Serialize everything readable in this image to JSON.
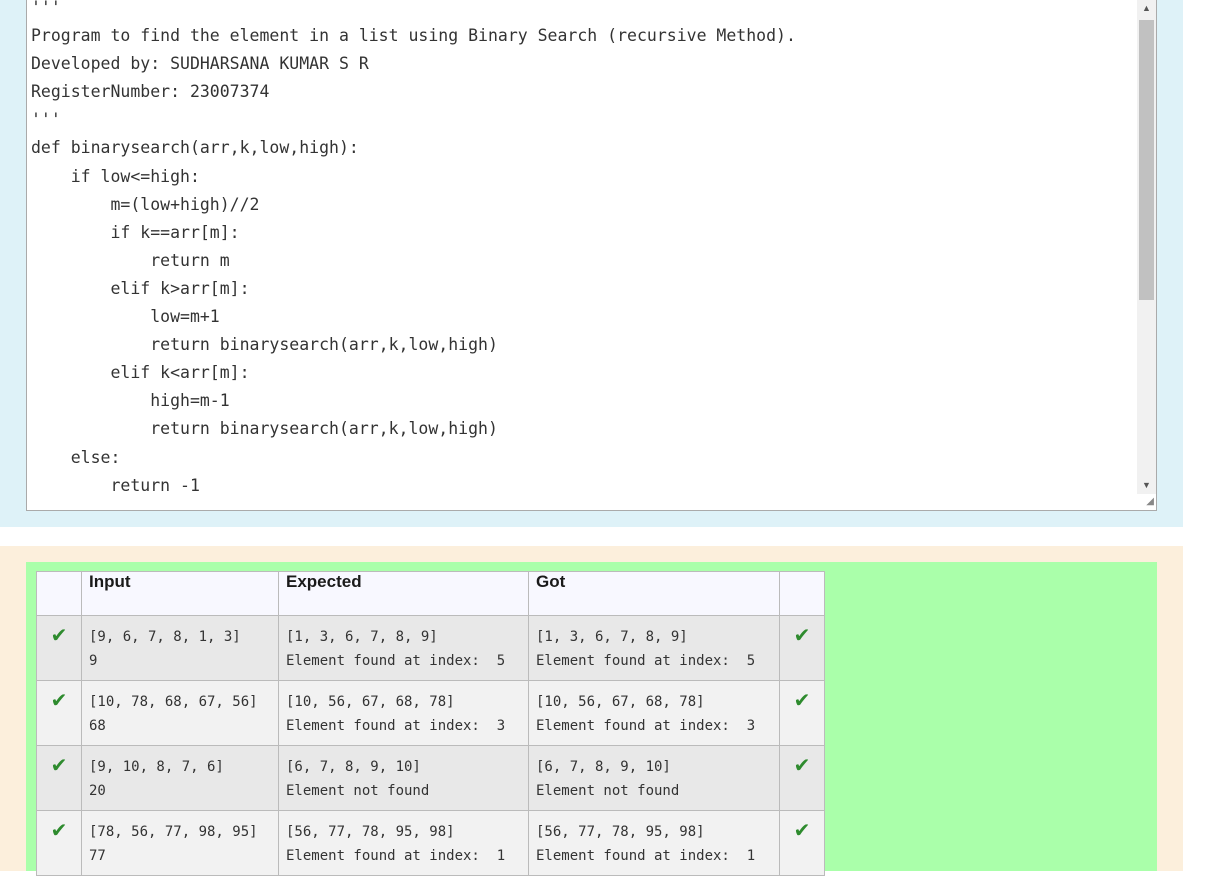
{
  "editor": {
    "code_lines": [
      "'''",
      "Program to find the element in a list using Binary Search (recursive Method).",
      "Developed by: SUDHARSANA KUMAR S R",
      "RegisterNumber: 23007374",
      "'''",
      "def binarysearch(arr,k,low,high):",
      "    if low<=high:",
      "        m=(low+high)//2",
      "        if k==arr[m]:",
      "            return m",
      "        elif k>arr[m]:",
      "            low=m+1",
      "            return binarysearch(arr,k,low,high)",
      "        elif k<arr[m]:",
      "            high=m-1",
      "            return binarysearch(arr,k,low,high)",
      "    else:",
      "        return -1"
    ],
    "scroll_up_icon": "triangle-up",
    "scroll_down_icon": "triangle-down"
  },
  "results": {
    "headers": {
      "input": "Input",
      "expected": "Expected",
      "got": "Got"
    },
    "rows": [
      {
        "passed": true,
        "input_1": "[9, 6, 7, 8, 1, 3]",
        "input_2": "9",
        "expected_1": "[1, 3, 6, 7, 8, 9]",
        "expected_2": "Element found at index:  5",
        "got_1": "[1, 3, 6, 7, 8, 9]",
        "got_2": "Element found at index:  5"
      },
      {
        "passed": true,
        "input_1": "[10, 78, 68, 67, 56]",
        "input_2": "68",
        "expected_1": "[10, 56, 67, 68, 78]",
        "expected_2": "Element found at index:  3",
        "got_1": "[10, 56, 67, 68, 78]",
        "got_2": "Element found at index:  3"
      },
      {
        "passed": true,
        "input_1": "[9, 10, 8, 7, 6]",
        "input_2": "20",
        "expected_1": "[6, 7, 8, 9, 10]",
        "expected_2": "Element not found",
        "got_1": "[6, 7, 8, 9, 10]",
        "got_2": "Element not found"
      },
      {
        "passed": true,
        "input_1": "[78, 56, 77, 98, 95]",
        "input_2": "77",
        "expected_1": "[56, 77, 78, 95, 98]",
        "expected_2": "Element found at index:  1",
        "got_1": "[56, 77, 78, 95, 98]",
        "got_2": "Element found at index:  1"
      }
    ],
    "pass_icon": "check-icon",
    "colors": {
      "pass_background": "#aaffaa",
      "check": "#2e8b2e"
    }
  }
}
